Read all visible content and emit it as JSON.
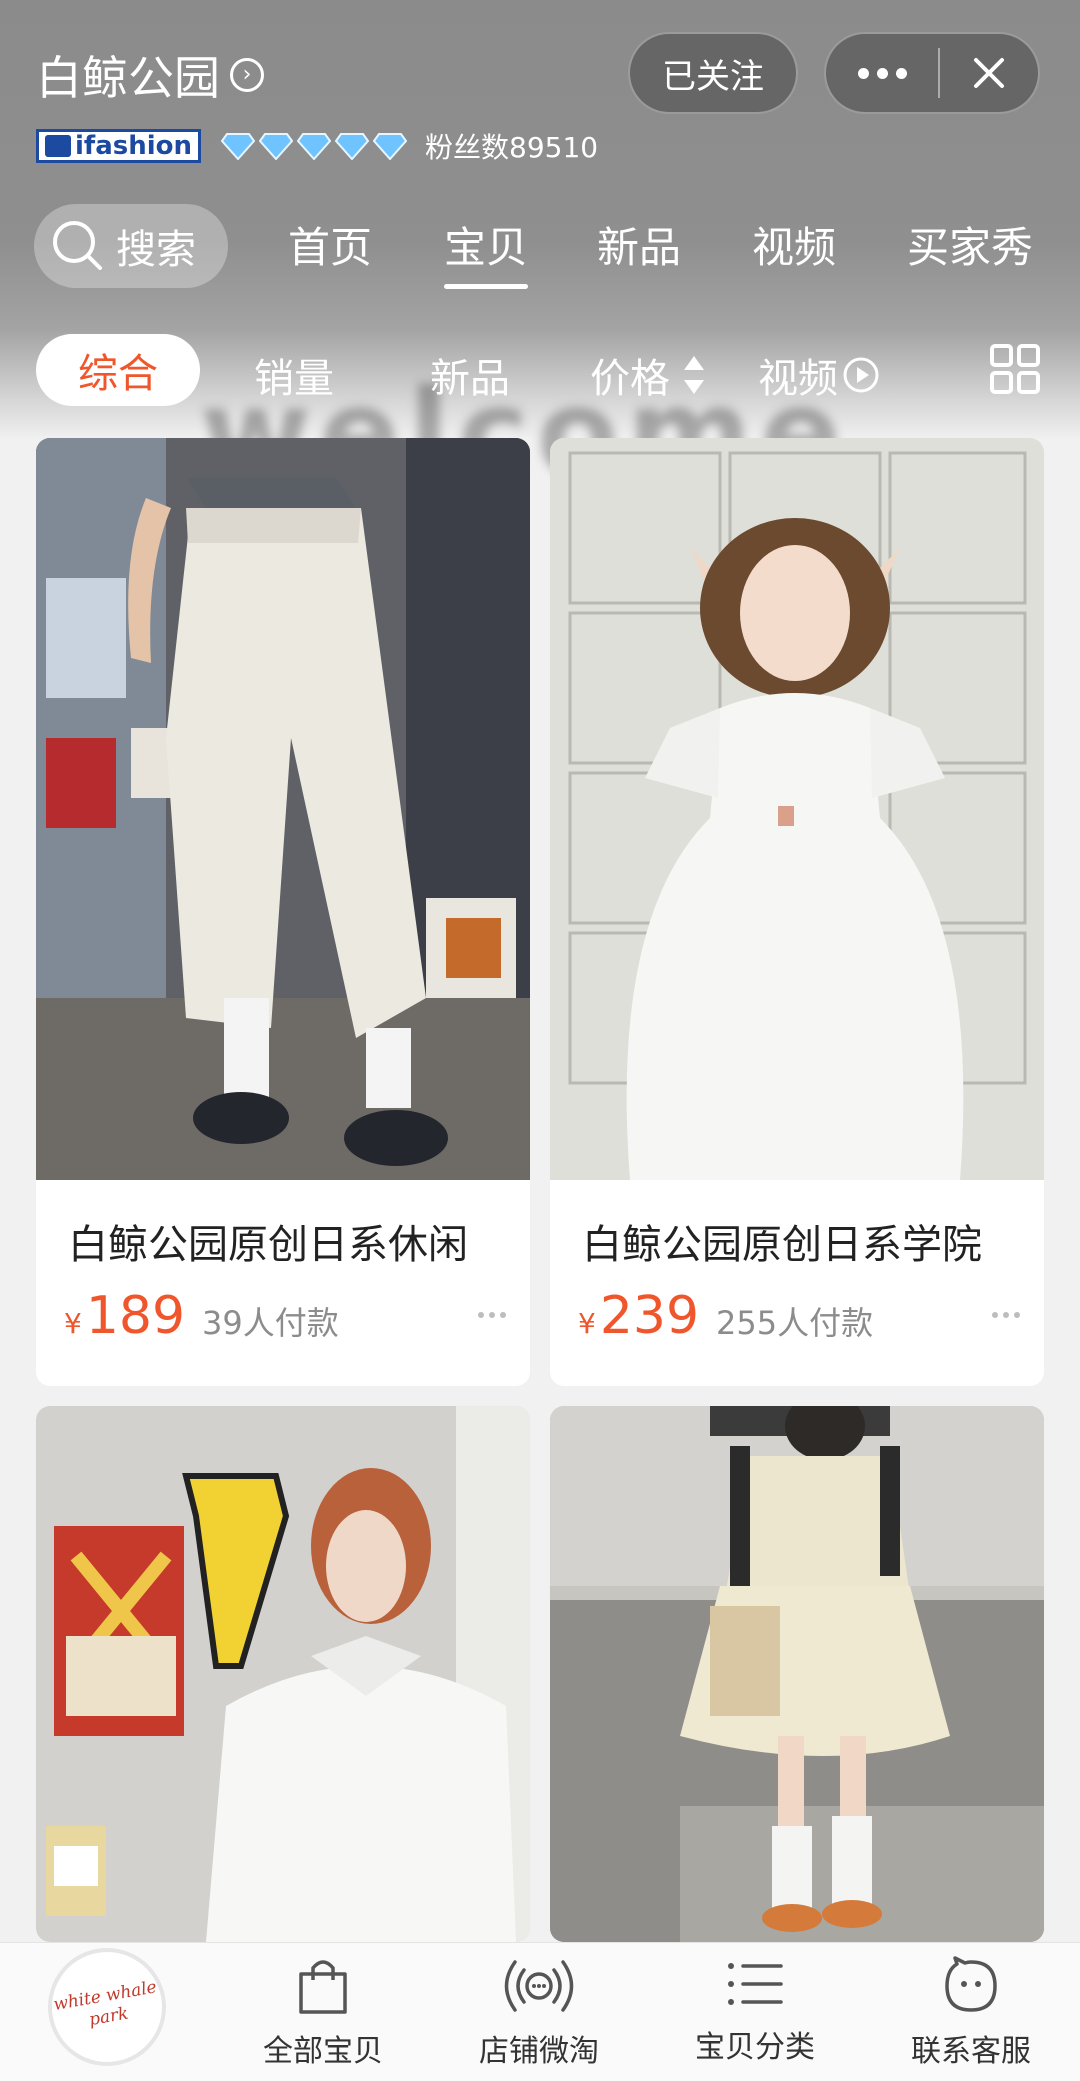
{
  "header": {
    "shop_name": "白鲸公园",
    "follow_label": "已关注",
    "badge_text": "ifashion",
    "fans_text": "粉丝数89510",
    "watermark_text": "welcome"
  },
  "nav": {
    "search_label": "搜索",
    "tabs": [
      {
        "label": "首页"
      },
      {
        "label": "宝贝"
      },
      {
        "label": "新品"
      },
      {
        "label": "视频"
      },
      {
        "label": "买家秀"
      }
    ],
    "active_tab": "宝贝"
  },
  "sort": {
    "items": [
      {
        "label": "综合"
      },
      {
        "label": "销量"
      },
      {
        "label": "新品"
      },
      {
        "label": "价格"
      },
      {
        "label": "视频"
      }
    ],
    "active": "综合"
  },
  "products": [
    {
      "title": "白鲸公园原创日系休闲",
      "currency": "¥",
      "price": "189",
      "sold": "39人付款"
    },
    {
      "title": "白鲸公园原创日系学院",
      "currency": "¥",
      "price": "239",
      "sold": "255人付款"
    },
    {
      "title": "",
      "currency": "",
      "price": "",
      "sold": ""
    },
    {
      "title": "",
      "currency": "",
      "price": "",
      "sold": ""
    }
  ],
  "bottom_bar": {
    "logo_text_1": "white whale",
    "logo_text_2": "park",
    "items": [
      {
        "label": "全部宝贝",
        "icon": "shopping-bag-icon"
      },
      {
        "label": "店铺微淘",
        "icon": "broadcast-icon"
      },
      {
        "label": "宝贝分类",
        "icon": "list-icon"
      },
      {
        "label": "联系客服",
        "icon": "chat-bubble-icon"
      }
    ]
  },
  "colors": {
    "accent": "#f0562b",
    "header_gray": "#8b8b8b",
    "badge_blue": "#1b4aa0"
  }
}
